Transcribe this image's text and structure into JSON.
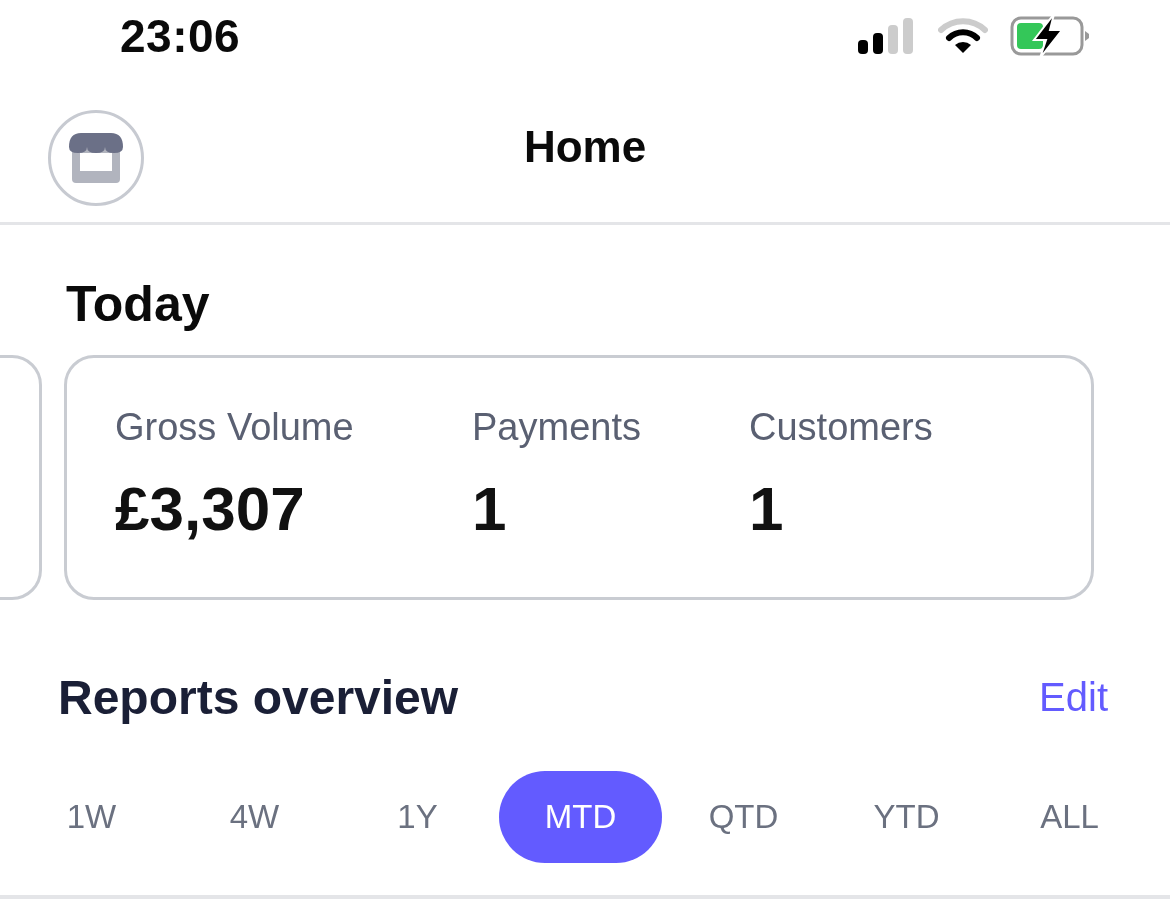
{
  "status_bar": {
    "time": "23:06"
  },
  "nav": {
    "title": "Home"
  },
  "today": {
    "heading": "Today",
    "stats": [
      {
        "label": "Gross Volume",
        "value": "£3,307"
      },
      {
        "label": "Payments",
        "value": "1"
      },
      {
        "label": "Customers",
        "value": "1"
      }
    ]
  },
  "reports": {
    "heading": "Reports overview",
    "edit": "Edit",
    "periods": [
      {
        "label": "1W",
        "selected": false
      },
      {
        "label": "4W",
        "selected": false
      },
      {
        "label": "1Y",
        "selected": false
      },
      {
        "label": "MTD",
        "selected": true
      },
      {
        "label": "QTD",
        "selected": false
      },
      {
        "label": "YTD",
        "selected": false
      },
      {
        "label": "ALL",
        "selected": false
      }
    ]
  }
}
